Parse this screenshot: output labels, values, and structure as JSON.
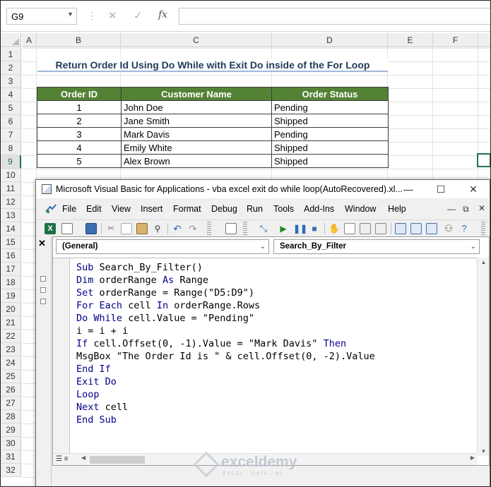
{
  "formula_bar": {
    "name_box": "G9",
    "cancel_icon": "✕",
    "enter_icon": "✓",
    "fx_label": "fx",
    "formula_value": ""
  },
  "sheet": {
    "columns": [
      "A",
      "B",
      "C",
      "D",
      "E",
      "F"
    ],
    "rows": [
      "1",
      "2",
      "3",
      "4",
      "5",
      "6",
      "7",
      "8",
      "9",
      "10",
      "11",
      "12",
      "13",
      "14",
      "15",
      "16",
      "17",
      "18",
      "19",
      "20",
      "21",
      "22",
      "23",
      "24",
      "25",
      "26",
      "27",
      "28",
      "29",
      "30",
      "31",
      "32"
    ],
    "selected_cell": "G9",
    "title": "Return Order Id Using Do While with Exit Do inside of the For Loop",
    "table": {
      "headers": [
        "Order ID",
        "Customer Name",
        "Order Status"
      ],
      "rows": [
        [
          "1",
          "John Doe",
          "Pending"
        ],
        [
          "2",
          "Jane Smith",
          "Shipped"
        ],
        [
          "3",
          "Mark Davis",
          "Pending"
        ],
        [
          "4",
          "Emily White",
          "Shipped"
        ],
        [
          "5",
          "Alex Brown",
          "Shipped"
        ]
      ]
    },
    "header_color": "#548235"
  },
  "vba_window": {
    "title": "Microsoft Visual Basic for Applications - vba excel exit do while loop(AutoRecovered).xl...",
    "menu": [
      "File",
      "Edit",
      "View",
      "Insert",
      "Format",
      "Debug",
      "Run",
      "Tools",
      "Add-Ins",
      "Window",
      "Help"
    ],
    "object_combo": "(General)",
    "procedure_combo": "Search_By_Filter",
    "keyword_color": "#00008b",
    "code_lines": [
      "Sub Search_By_Filter()",
      "Dim orderRange As Range",
      "Set orderRange = Range(\"D5:D9\")",
      "For Each cell In orderRange.Rows",
      "Do While cell.Value = \"Pending\"",
      "i = i + i",
      "If cell.Offset(0, -1).Value = \"Mark Davis\" Then",
      "MsgBox \"The Order Id is \" & cell.Offset(0, -2).Value",
      "End If",
      "Exit Do",
      "Loop",
      "Next cell",
      "End Sub"
    ]
  },
  "watermark": {
    "name": "exceldemy",
    "tagline": "EXCEL · DATA · BI"
  }
}
